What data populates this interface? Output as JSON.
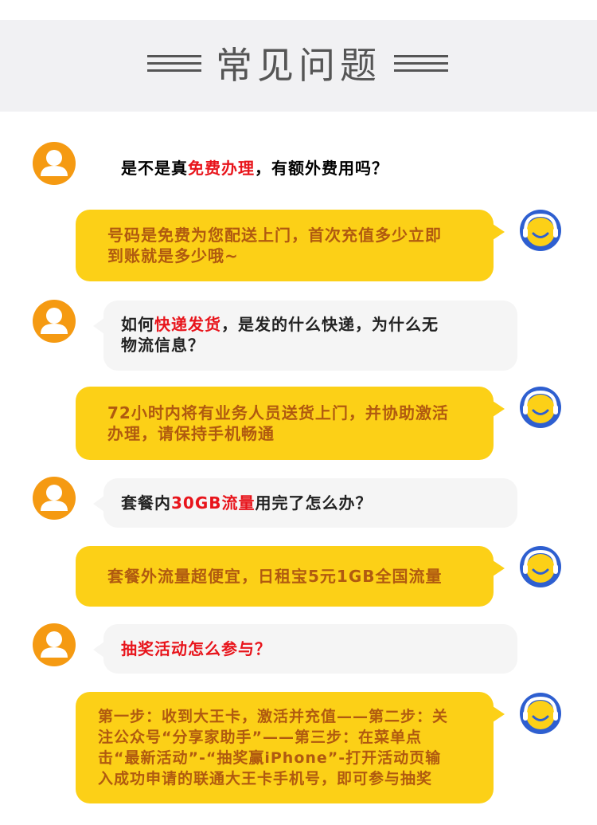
{
  "header": {
    "title": "常见问题"
  },
  "colors": {
    "accent_yellow": "#fcd017",
    "highlight_red": "#e8141b",
    "user_avatar_orange": "#f59a12",
    "agent_avatar_blue": "#2e5fd0"
  },
  "faq": [
    {
      "question": {
        "before": "是不是真",
        "highlight": "免费办理",
        "after": "，有额外费用吗？"
      },
      "answer": {
        "line1": "号码是免费为您配送上门，首次充值多少立即",
        "line2": "到账就是多少哦~"
      }
    },
    {
      "question": {
        "before": "如何",
        "highlight": "快递发货",
        "after_line1": "，是发的什么快递，为什么无",
        "after_line2": "物流信息？"
      },
      "answer": {
        "line1": "72小时内将有业务人员送货上门，并协助激活",
        "line2": "办理，请保持手机畅通"
      }
    },
    {
      "question": {
        "before": "套餐内",
        "highlight": "30GB流量",
        "after": "用完了怎么办？"
      },
      "answer": {
        "line1": "套餐外流量超便宜，日租宝5元1GB全国流量"
      }
    },
    {
      "question": {
        "highlight": "抽奖活动怎么参与？"
      },
      "answer": {
        "line1": "第一步：收到大王卡，激活并充值——第二步：关",
        "line2": "注公众号“分享家助手”——第三步：在菜单点",
        "line3": "击“最新活动”-“抽奖赢iPhone”-打开活动页输",
        "line4": "入成功申请的联通大王卡手机号，即可参与抽奖"
      }
    }
  ]
}
